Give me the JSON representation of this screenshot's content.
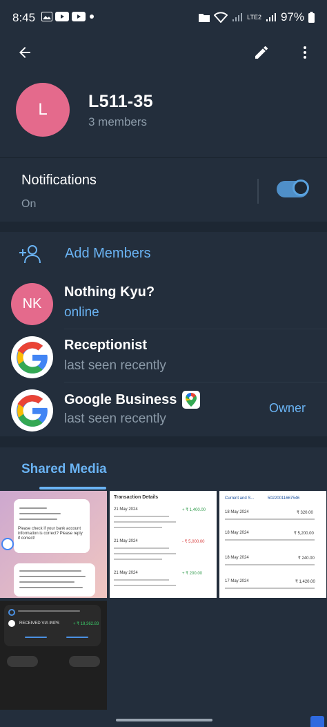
{
  "status_bar": {
    "time": "8:45",
    "battery": "97%",
    "network": "LTE2"
  },
  "group": {
    "avatar_letter": "L",
    "name": "L511-35",
    "members_count": "3 members"
  },
  "notifications": {
    "label": "Notifications",
    "status": "On",
    "enabled": true
  },
  "add_members_label": "Add Members",
  "members": [
    {
      "initials": "NK",
      "name": "Nothing Kyu?",
      "status": "online",
      "role": ""
    },
    {
      "initials": "",
      "name": "Receptionist",
      "status": "last seen recently",
      "role": ""
    },
    {
      "initials": "",
      "name": "Google Business",
      "status": "last seen recently",
      "role": "Owner"
    }
  ],
  "shared_media": {
    "title": "Shared Media",
    "thumbnails": [
      {
        "title": "",
        "lines": [
          "Please check if your bank account information is correct? Please reply if correct!"
        ]
      },
      {
        "title": "Transaction Details",
        "lines": [
          "21 May 2024",
          "+ ₹ 1,400.00",
          "21 May 2024",
          "- ₹ 5,000.00",
          "21 May 2024",
          "+ ₹ 200.00"
        ]
      },
      {
        "title": "Current and S...",
        "lines": [
          "50220011667546",
          "18 May 2024",
          "₹ 320.00",
          "18 May 2024",
          "₹ 5,200.00",
          "18 May 2024",
          "₹ 240.00",
          "17 May 2024",
          "₹ 1,420.00"
        ]
      },
      {
        "title": "RECEIVED VIA IMPS",
        "lines": [
          "+ ₹ 18,362.83"
        ]
      }
    ]
  },
  "colors": {
    "background": "#1d2733",
    "surface": "#232e3c",
    "accent": "#6ab3f3",
    "avatar_pink": "#e46a8c"
  }
}
